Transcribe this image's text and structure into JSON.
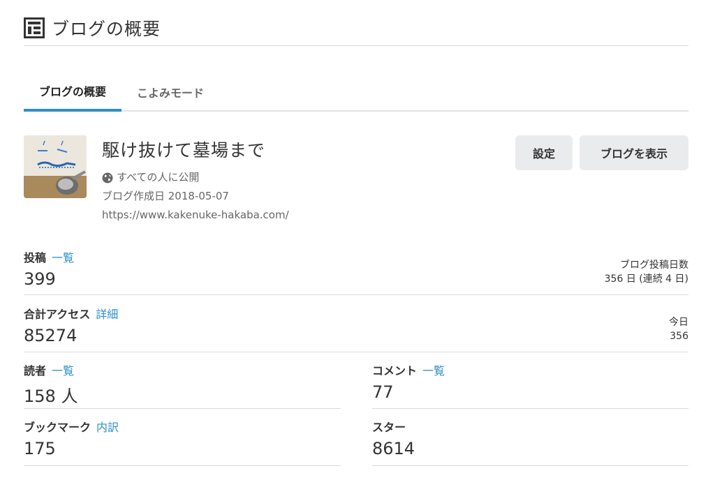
{
  "header": {
    "title": "ブログの概要",
    "icon": "dashboard-icon"
  },
  "tabs": [
    {
      "label": "ブログの概要",
      "active": true
    },
    {
      "label": "こよみモード",
      "active": false
    }
  ],
  "blog": {
    "name": "駆け抜けて墓場まで",
    "visibility": "すべての人に公開",
    "created": "ブログ作成日 2018-05-07",
    "url": "https://www.kakenuke-hakaba.com/"
  },
  "buttons": {
    "settings": "設定",
    "view": "ブログを表示"
  },
  "stats": {
    "posts": {
      "label": "投稿",
      "link": "一覧",
      "value": "399",
      "side_label": "ブログ投稿日数",
      "side_value": "356 日 (連続 4 日)"
    },
    "access": {
      "label": "合計アクセス",
      "link": "詳細",
      "value": "85274",
      "side_label": "今日",
      "side_value": "356"
    },
    "readers": {
      "label": "読者",
      "link": "一覧",
      "value": "158 人"
    },
    "comments": {
      "label": "コメント",
      "link": "一覧",
      "value": "77"
    },
    "bookmarks": {
      "label": "ブックマーク",
      "link": "内訳",
      "value": "175"
    },
    "stars": {
      "label": "スター",
      "value": "8614"
    }
  },
  "colors": {
    "accent": "#2c8fc9",
    "button_bg": "#e9ebed"
  }
}
